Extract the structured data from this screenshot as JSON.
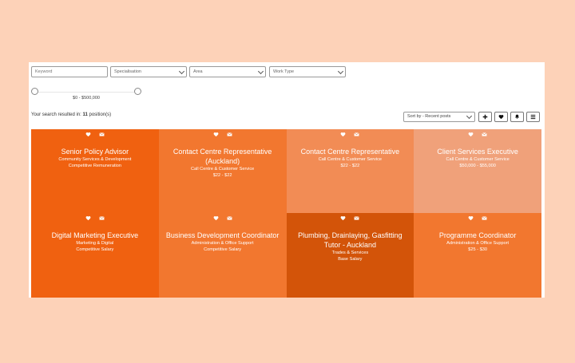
{
  "filters": {
    "keyword_placeholder": "Keyword",
    "specialisation": "Specialisation",
    "area": "Area",
    "work_type": "Work Type"
  },
  "salary_range": "$0 - $500,000",
  "results": {
    "prefix": "Your search resulted in: ",
    "count": "11",
    "suffix": " position(s)"
  },
  "sort": {
    "selected": "Sort by - Recent posts"
  },
  "toolbar_icons": [
    "plus-icon",
    "heart-icon",
    "bell-icon",
    "list-icon"
  ],
  "colors": {
    "page_bg": "#fdd2b8",
    "tile_1": "#f06110",
    "tile_2": "#f2772f",
    "tile_3": "#f28c55",
    "tile_4": "#f0a17a",
    "tile_5": "#f06110",
    "tile_6": "#f2772f",
    "tile_7": "#d35409",
    "tile_8": "#f2772f"
  },
  "jobs": [
    {
      "title": "Senior Policy Advisor",
      "category": "Community Services & Development",
      "pay": "Competitive Remuneration"
    },
    {
      "title": "Contact Centre Representative (Auckland)",
      "category": "Call Centre & Customer Service",
      "pay": "$22 - $22"
    },
    {
      "title": "Contact Centre Representative",
      "category": "Call Centre & Customer Service",
      "pay": "$22 - $22"
    },
    {
      "title": "Client Services Executive",
      "category": "Call Centre & Customer Service",
      "pay": "$50,000 - $55,000"
    },
    {
      "title": "Digital Marketing Executive",
      "category": "Marketing & Digital",
      "pay": "Competitive Salary"
    },
    {
      "title": "Business Development Coordinator",
      "category": "Administration & Office Support",
      "pay": "Competitive Salary"
    },
    {
      "title": "Plumbing, Drainlaying, Gasfitting Tutor - Auckland",
      "category": "Trades & Services",
      "pay": "Base Salary"
    },
    {
      "title": "Programme Coordinator",
      "category": "Administration & Office Support",
      "pay": "$25 - $30"
    }
  ]
}
